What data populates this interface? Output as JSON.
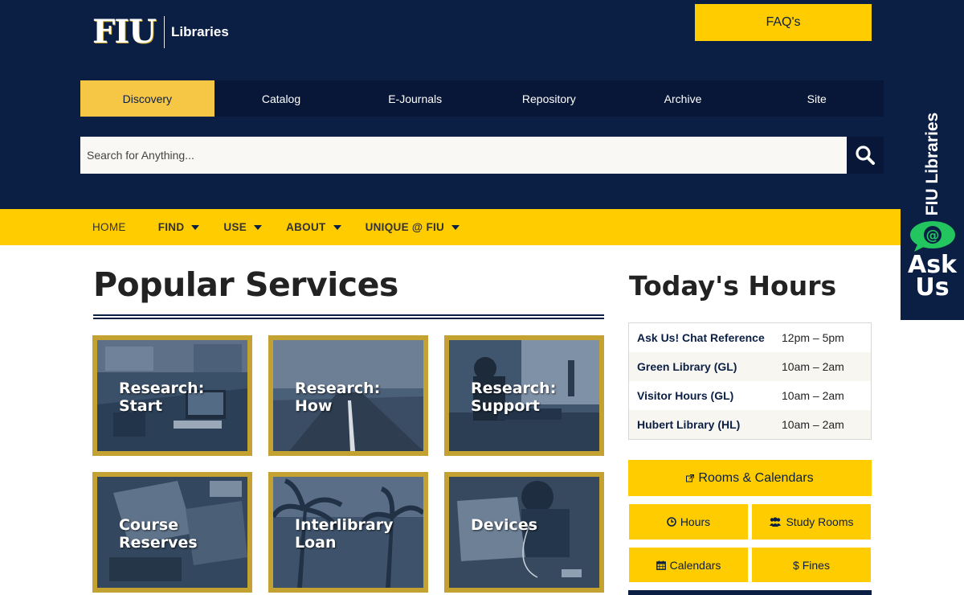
{
  "header": {
    "logo_mark": "FIU",
    "logo_text": "Libraries",
    "faq_label": "FAQ's"
  },
  "search_tabs": [
    {
      "label": "Discovery",
      "active": true
    },
    {
      "label": "Catalog"
    },
    {
      "label": "E-Journals"
    },
    {
      "label": "Repository"
    },
    {
      "label": "Archive"
    },
    {
      "label": "Site"
    }
  ],
  "search": {
    "placeholder": "Search for Anything...",
    "button_icon": "search-icon"
  },
  "main_nav": [
    {
      "label": "HOME"
    },
    {
      "label": "FIND",
      "dropdown": true
    },
    {
      "label": "USE",
      "dropdown": true
    },
    {
      "label": "ABOUT",
      "dropdown": true
    },
    {
      "label": "UNIQUE @ FIU",
      "dropdown": true
    }
  ],
  "ask_us": {
    "vertical_text": "FIU Libraries",
    "bubble_symbol": "@",
    "label_line1": "Ask",
    "label_line2": "Us"
  },
  "popular_services": {
    "title": "Popular Services",
    "tiles": [
      {
        "line1": "Research:",
        "line2": "Start"
      },
      {
        "line1": "Research:",
        "line2": "How"
      },
      {
        "line1": "Research:",
        "line2": "Support"
      },
      {
        "line1": "Course",
        "line2": "Reserves"
      },
      {
        "line1": "Interlibrary",
        "line2": "Loan"
      },
      {
        "line1": "Devices",
        "line2": ""
      }
    ]
  },
  "todays_hours": {
    "title": "Today's Hours",
    "rows": [
      {
        "name": "Ask Us! Chat Reference",
        "time": "12pm – 5pm"
      },
      {
        "name": "Green Library (GL)",
        "time": "10am – 2am"
      },
      {
        "name": "Visitor Hours (GL)",
        "time": "10am – 2am"
      },
      {
        "name": "Hubert Library (HL)",
        "time": "10am – 2am"
      }
    ],
    "rooms_calendars": "Rooms & Calendars",
    "hours": "Hours",
    "study_rooms": "Study Rooms",
    "calendars": "Calendars",
    "fines": "$ Fines"
  },
  "colors": {
    "navy": "#0b1f45",
    "gold": "#ffcc00",
    "tile_border": "#c4a232"
  }
}
